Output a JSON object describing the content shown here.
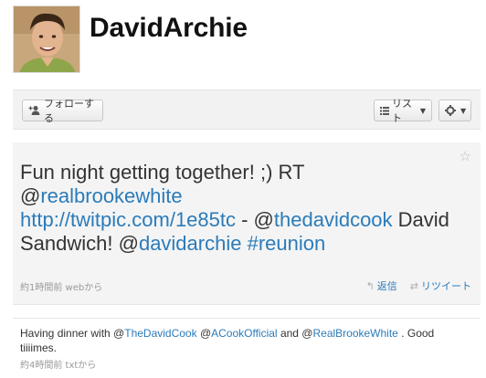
{
  "profile": {
    "username": "DavidArchie"
  },
  "toolbar": {
    "follow_label": "フォローする",
    "list_label": "リスト",
    "gear_icon": "gear-icon"
  },
  "tweet_main": {
    "text_pre": "Fun night getting together! ;) RT @",
    "mention1": "realbrookewhite",
    "link": "http://twitpic.com/1e85tc",
    "sep": " - @",
    "mention2": "thedavidcook",
    "text_mid": " David Sandwich! @",
    "mention3": "davidarchie",
    "space": " ",
    "hashtag": "#reunion",
    "meta": "約1時間前 webから",
    "reply_label": "返信",
    "retweet_label": "リツイート"
  },
  "tweet_secondary": {
    "text_pre": "Having dinner with @",
    "mention1": "TheDavidCook",
    "sep1": " @",
    "mention2": "ACookOfficial",
    "text_mid": " and @",
    "mention3": "RealBrookeWhite",
    "text_end": " . Good tiiiimes.",
    "meta": "約4時間前 txtから"
  },
  "colors": {
    "link": "#2b7bb9",
    "meta": "#999999",
    "tweet_bg": "#f4f4f4"
  }
}
